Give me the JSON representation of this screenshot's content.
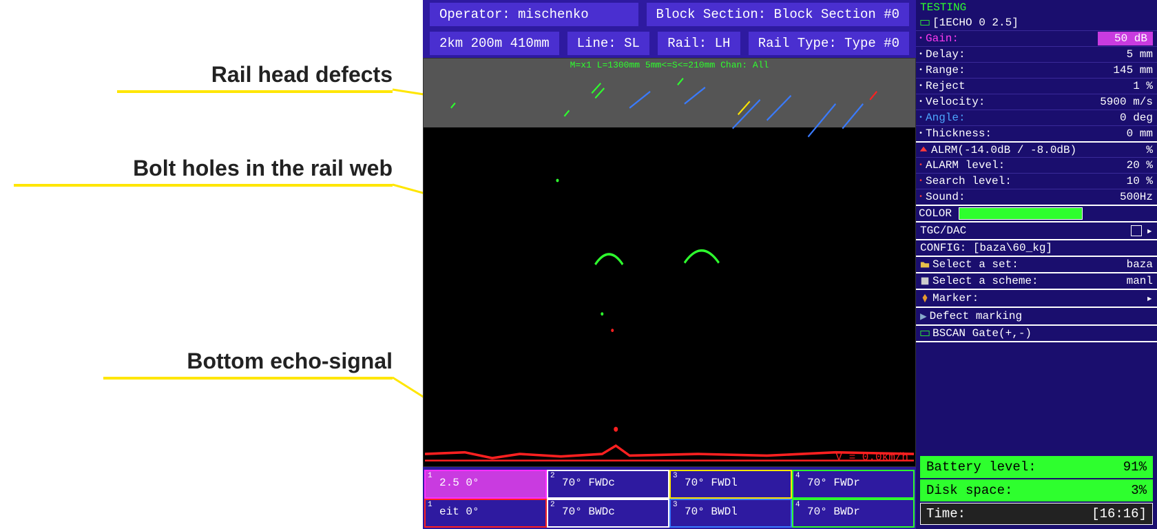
{
  "annotations": {
    "rail_head": "Rail head defects",
    "bolt_holes": "Bolt holes in the rail web",
    "bottom_echo": "Bottom echo-signal"
  },
  "header": {
    "operator_label": "Operator:",
    "operator_value": "mischenko",
    "block_label": "Block Section:",
    "block_value": "Block Section #0",
    "position": "2km  200m  410mm",
    "line_label": "Line:",
    "line_value": "SL",
    "rail_label": "Rail:",
    "rail_value": "LH",
    "railtype_label": "Rail Type:",
    "railtype_value": "Type #0"
  },
  "bscan": {
    "info": "M=x1  L=1300mm 5mm<=S<=210mm Chan: All",
    "velocity": "V = 0.0km/h"
  },
  "channels": {
    "row1": [
      {
        "num": "1",
        "label": "2.5 0°",
        "border": "#ff2eff",
        "selected": true
      },
      {
        "num": "2",
        "label": "70° FWDc",
        "border": "#ffffff",
        "selected": false
      },
      {
        "num": "3",
        "label": "70° FWDl",
        "border": "#ffe600",
        "selected": false
      },
      {
        "num": "4",
        "label": "70° FWDr",
        "border": "#2eff2e",
        "selected": false
      }
    ],
    "row2": [
      {
        "num": "1",
        "label": "eit 0°",
        "border": "#ff2020",
        "selected": false
      },
      {
        "num": "2",
        "label": "70° BWDc",
        "border": "#ffffff",
        "selected": false
      },
      {
        "num": "3",
        "label": "70° BWDl",
        "border": "#3a7bff",
        "selected": false
      },
      {
        "num": "4",
        "label": "70° BWDr",
        "border": "#2eff2e",
        "selected": false
      }
    ]
  },
  "sidebar": {
    "mode": "TESTING",
    "channel": "[1ECHO 0 2.5]",
    "params": [
      {
        "key": "gain",
        "label": "Gain:",
        "value": "50 dB",
        "bullet": "magenta",
        "hl": true
      },
      {
        "key": "delay",
        "label": "Delay:",
        "value": "5 mm",
        "bullet": "white"
      },
      {
        "key": "range",
        "label": "Range:",
        "value": "145 mm",
        "bullet": "white"
      },
      {
        "key": "reject",
        "label": "Reject",
        "value": "1 %",
        "bullet": "white"
      },
      {
        "key": "velocity",
        "label": "Velocity:",
        "value": "5900 m/s",
        "bullet": "white"
      },
      {
        "key": "angle",
        "label": "Angle:",
        "value": "0 deg",
        "bullet": "blue"
      },
      {
        "key": "thickness",
        "label": "Thickness:",
        "value": "0 mm",
        "bullet": "white"
      }
    ],
    "alrm_header": "ALRM(-14.0dB / -8.0dB)",
    "alrm_header_val": "%",
    "alarm_params": [
      {
        "label": "ALARM level:",
        "value": "20 %",
        "bullet": "red"
      },
      {
        "label": "Search level:",
        "value": "10 %",
        "bullet": "red"
      },
      {
        "label": "Sound:",
        "value": "500Hz",
        "bullet": "red"
      }
    ],
    "color_label": "COLOR",
    "tgc_label": "TGC/DAC",
    "config_label": "CONFIG: [baza\\60_kg]",
    "select_set_label": "Select a set:",
    "select_set_value": "baza",
    "select_scheme_label": "Select a scheme:",
    "select_scheme_value": "manl",
    "marker_label": "Marker:",
    "defect_label": "Defect marking",
    "gate_label": "BSCAN Gate(+,-)"
  },
  "status": {
    "battery_label": "Battery level:",
    "battery_value": "91%",
    "disk_label": "Disk space:",
    "disk_value": "3%",
    "time_label": "Time:",
    "time_value": "[16:16]"
  }
}
